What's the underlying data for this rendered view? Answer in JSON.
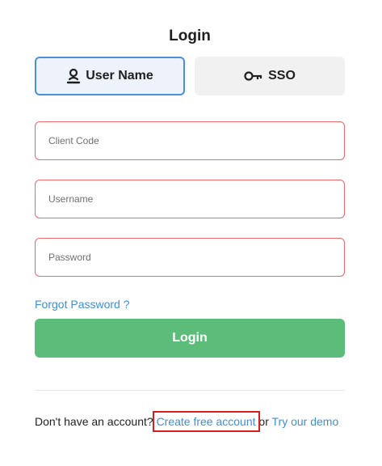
{
  "title": "Login",
  "tabs": {
    "user_name": {
      "label": "User Name",
      "icon": "user-icon",
      "active": true
    },
    "sso": {
      "label": "SSO",
      "icon": "key-icon",
      "active": false
    }
  },
  "form": {
    "client_code": {
      "placeholder": "Client Code",
      "value": ""
    },
    "username": {
      "placeholder": "Username",
      "value": ""
    },
    "password": {
      "placeholder": "Password",
      "value": ""
    }
  },
  "forgot_password": "Forgot Password ?",
  "login_button": "Login",
  "signup": {
    "prefix": "Don't have an account? ",
    "create_link": "Create free account",
    "or": " or ",
    "demo_link": "Try our demo"
  },
  "colors": {
    "accent": "#4a90d9",
    "link": "#3d8fd6",
    "login_button": "#5cbd7b",
    "field_border": "#e86a6a",
    "highlight": "#d62020"
  }
}
